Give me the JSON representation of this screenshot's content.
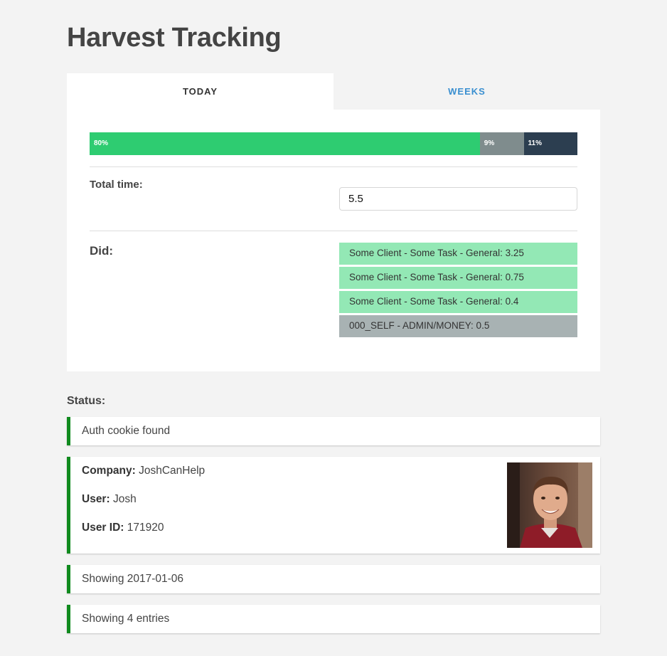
{
  "header": {
    "title": "Harvest Tracking"
  },
  "tabs": [
    {
      "label": "TODAY",
      "active": true
    },
    {
      "label": "WEEKS",
      "active": false
    }
  ],
  "progress": {
    "segments": [
      {
        "label": "80%",
        "value": 80,
        "color": "#2ecc71"
      },
      {
        "label": "9%",
        "value": 9,
        "color": "#7f8c8d"
      },
      {
        "label": "11%",
        "value": 11,
        "color": "#2c3e50"
      }
    ]
  },
  "total_time": {
    "label": "Total time:",
    "value": "5.5"
  },
  "did": {
    "label": "Did:",
    "entries": [
      {
        "text": "Some Client - Some Task - General: 3.25",
        "color": "#93e8b5"
      },
      {
        "text": "Some Client - Some Task - General: 0.75",
        "color": "#93e8b5"
      },
      {
        "text": "Some Client - Some Task - General: 0.4",
        "color": "#93e8b5"
      },
      {
        "text": "000_SELF - ADMIN/MONEY: 0.5",
        "color": "#a8b2b3"
      }
    ]
  },
  "status": {
    "heading": "Status:",
    "auth": "Auth cookie found",
    "company_label": "Company:",
    "company": "JoshCanHelp",
    "user_label": "User:",
    "user": "Josh",
    "user_id_label": "User ID:",
    "user_id": "171920",
    "showing_date": "Showing 2017-01-06",
    "showing_entries": "Showing 4 entries"
  },
  "colors": {
    "status_accent": "#0f8a1e",
    "link": "#3a8fd0"
  }
}
